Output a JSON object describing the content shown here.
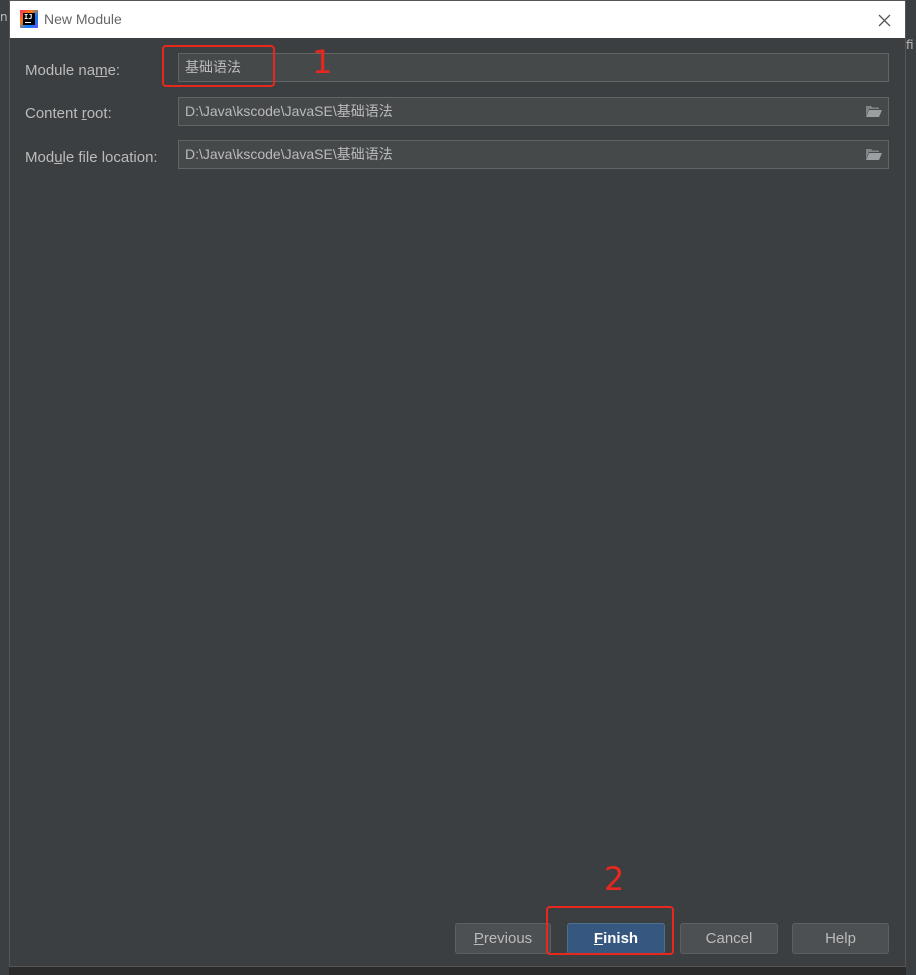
{
  "window": {
    "title": "New Module"
  },
  "background": {
    "left_peek": "n",
    "right_peek": "fi"
  },
  "form": {
    "module_name": {
      "label_pre": "Module na",
      "label_mnemonic": "m",
      "label_post": "e:",
      "value": "基础语法"
    },
    "content_root": {
      "label_pre": "Content ",
      "label_mnemonic": "r",
      "label_post": "oot:",
      "value": "D:\\Java\\kscode\\JavaSE\\基础语法"
    },
    "module_file_location": {
      "label_pre": "Mod",
      "label_mnemonic": "u",
      "label_post": "le file location:",
      "value": "D:\\Java\\kscode\\JavaSE\\基础语法"
    }
  },
  "annotations": {
    "step1": "1",
    "step2": "2",
    "color": "#e8281f"
  },
  "buttons": {
    "previous": {
      "mnemonic": "P",
      "rest": "revious"
    },
    "finish": {
      "mnemonic": "F",
      "rest": "inish"
    },
    "cancel": {
      "label": "Cancel"
    },
    "help": {
      "label": "Help"
    }
  },
  "colors": {
    "dialog_bg": "#3c3f41",
    "field_bg": "#45494a",
    "primary_button": "#365880",
    "text": "#bbbbbb"
  }
}
